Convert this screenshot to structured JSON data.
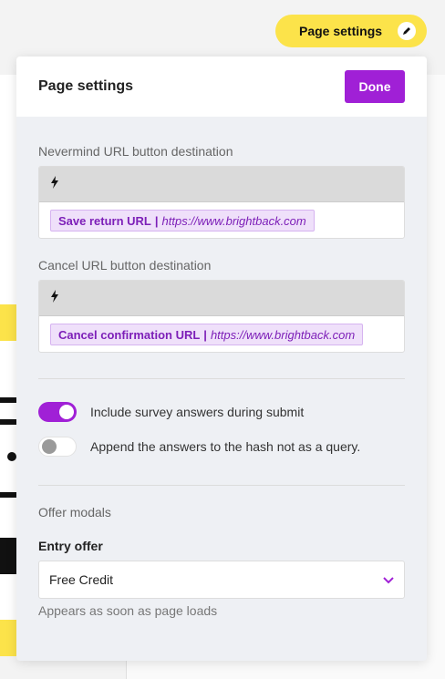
{
  "top_pill": {
    "label": "Page settings"
  },
  "panel": {
    "title": "Page settings",
    "done_label": "Done",
    "nevermind": {
      "label": "Nevermind URL button destination",
      "token_name": "Save return URL",
      "token_sep": "|",
      "token_url": "https://www.brightback.com"
    },
    "cancel": {
      "label": "Cancel URL button destination",
      "token_name": "Cancel confirmation URL",
      "token_sep": "|",
      "token_url": "https://www.brightback.com"
    },
    "toggles": [
      {
        "label": "Include survey answers during submit",
        "on": true
      },
      {
        "label": "Append the answers to the hash not as a query.",
        "on": false
      }
    ],
    "offer_modals": {
      "heading": "Offer modals",
      "entry_offer_label": "Entry offer",
      "entry_offer_value": "Free Credit",
      "helper": "Appears as soon as page loads"
    }
  },
  "colors": {
    "accent": "#a020d6",
    "pill": "#fce34a",
    "token_bg": "#efe0fa"
  },
  "icons": [
    "pencil-icon",
    "lightning-icon",
    "chevron-down-icon"
  ]
}
